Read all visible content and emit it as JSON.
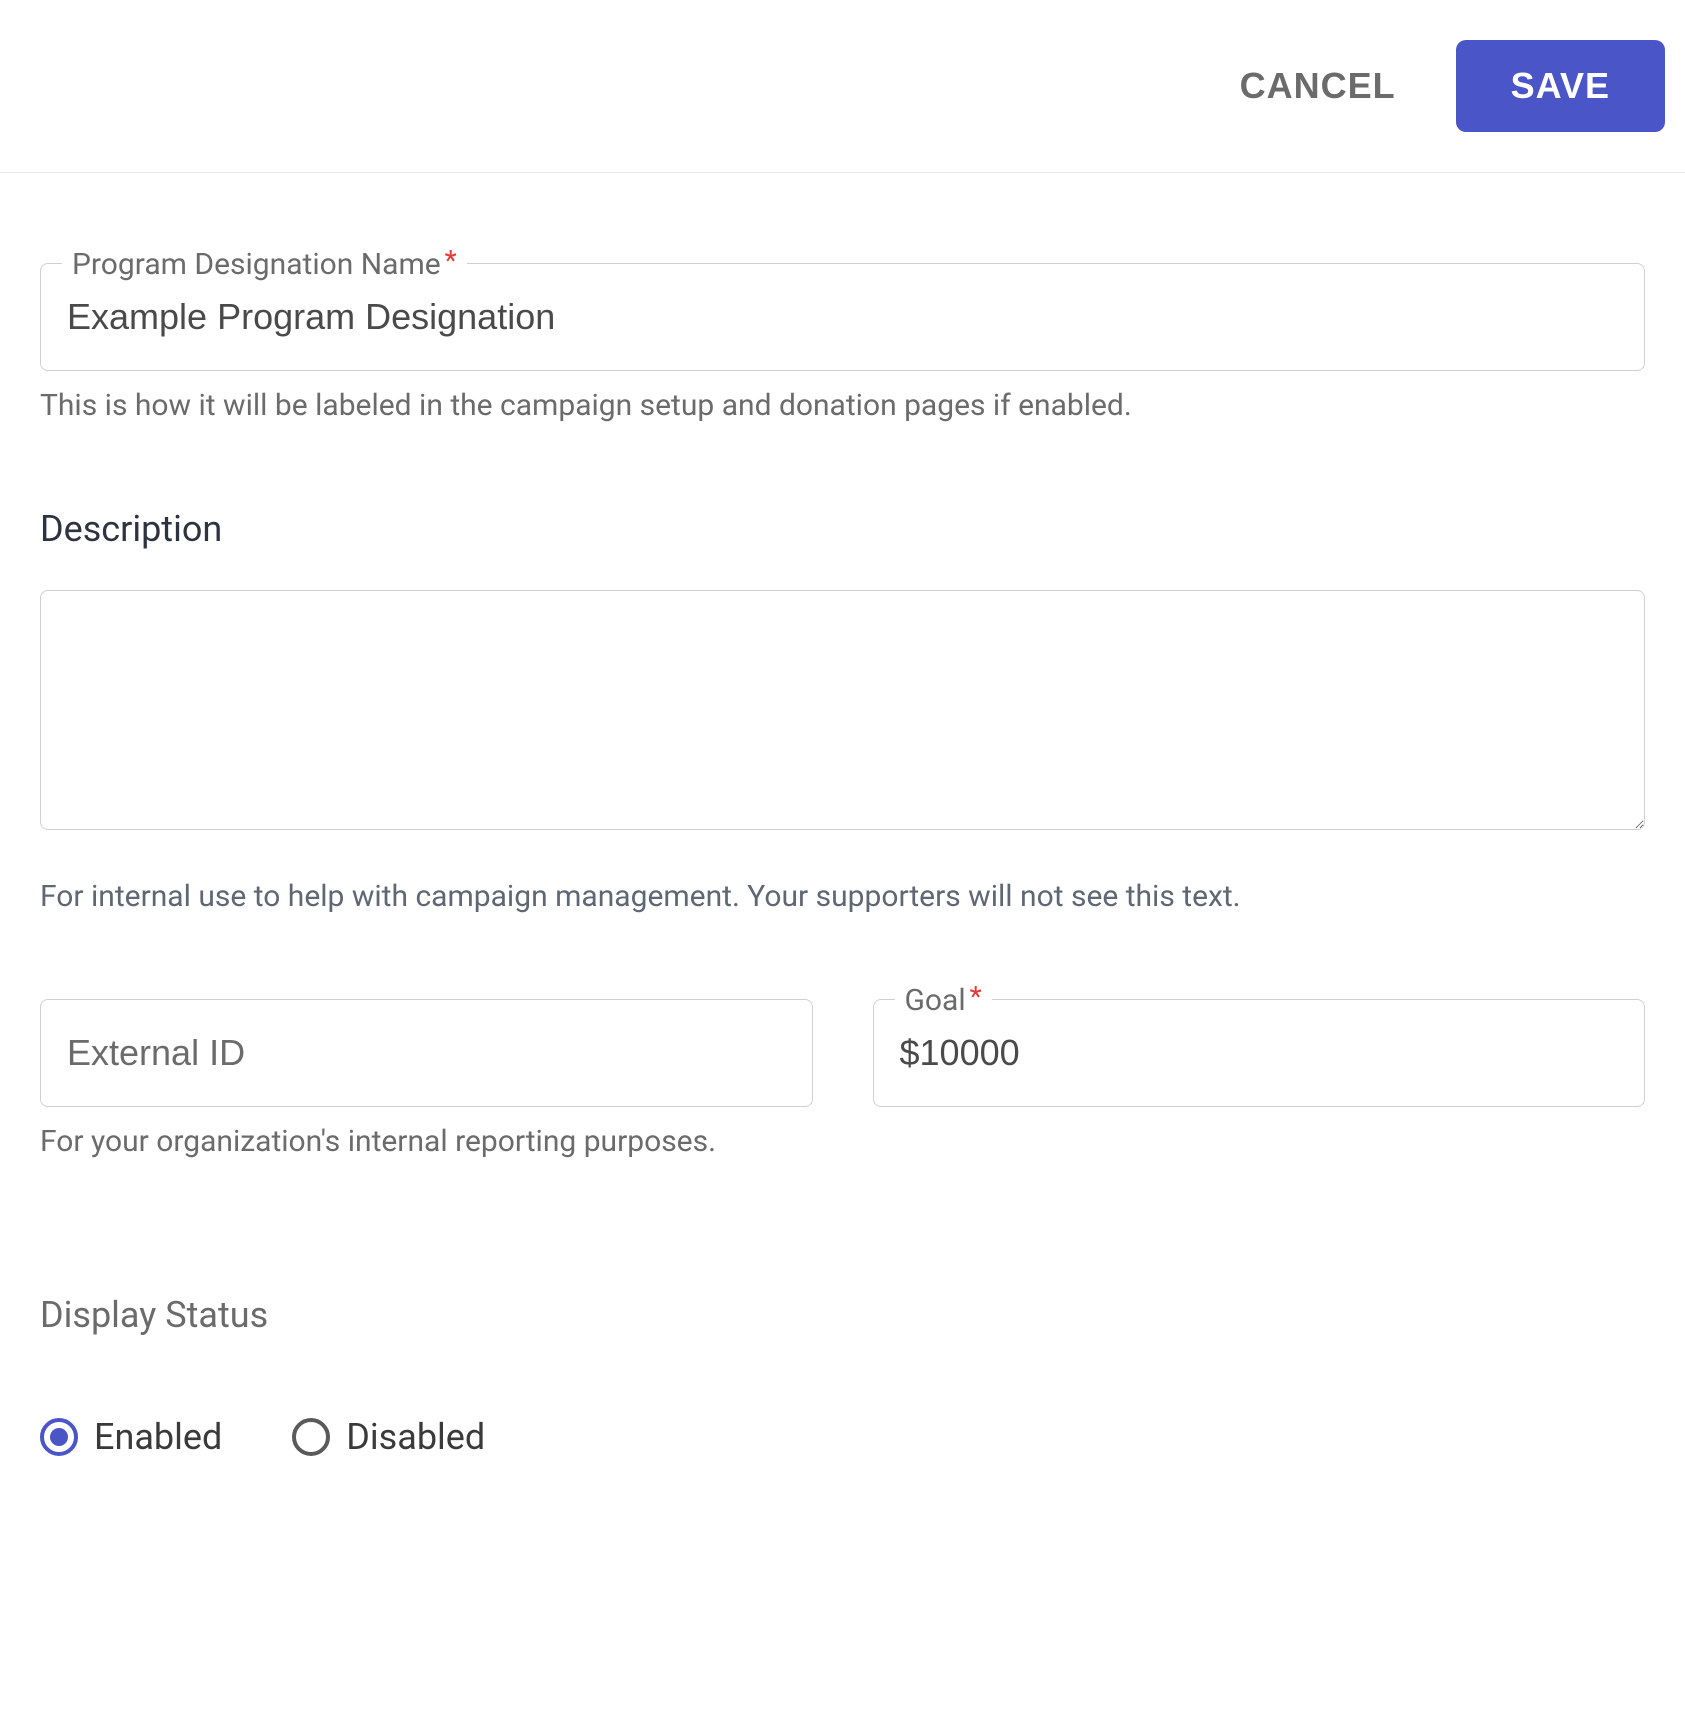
{
  "header": {
    "cancel_label": "CANCEL",
    "save_label": "SAVE"
  },
  "form": {
    "name": {
      "label": "Program Designation Name",
      "value": "Example Program Designation",
      "helper": "This is how it will be labeled in the campaign setup and donation pages if enabled."
    },
    "description": {
      "label": "Description",
      "value": "",
      "helper": "For internal use to help with campaign management. Your supporters will not see this text."
    },
    "external_id": {
      "placeholder": "External ID",
      "value": "",
      "helper": "For your organization's internal reporting purposes."
    },
    "goal": {
      "label": "Goal",
      "value": "$10000"
    },
    "display_status": {
      "label": "Display Status",
      "options": {
        "enabled": "Enabled",
        "disabled": "Disabled"
      },
      "selected": "enabled"
    }
  }
}
